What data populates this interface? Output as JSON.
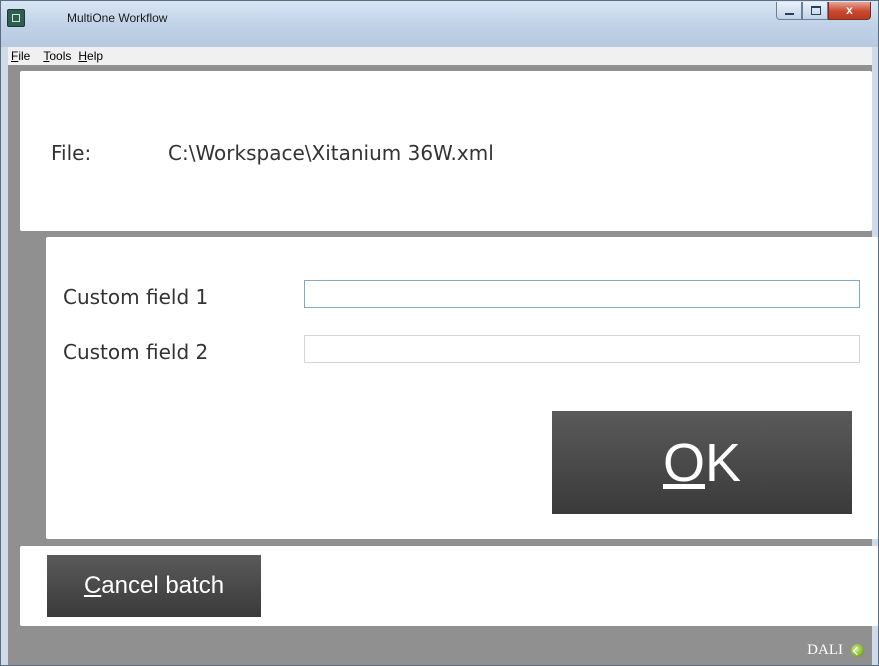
{
  "window": {
    "title": "MultiOne Workflow",
    "controls": [
      "minimize-icon",
      "maximize-icon",
      "close-icon"
    ]
  },
  "menu": {
    "file": {
      "mnemonic": "F",
      "rest": "ile"
    },
    "tools": {
      "mnemonic": "T",
      "rest": "ools"
    },
    "help": {
      "mnemonic": "H",
      "rest": "elp"
    }
  },
  "file_panel": {
    "label": "File:",
    "path": "C:\\Workspace\\Xitanium 36W.xml"
  },
  "form": {
    "field1": {
      "label": "Custom field 1",
      "value": "",
      "placeholder": ""
    },
    "field2": {
      "label": "Custom field 2",
      "value": "",
      "placeholder": ""
    },
    "ok": {
      "mnemonic": "O",
      "rest": "K"
    }
  },
  "bottom": {
    "cancel": {
      "mnemonic": "C",
      "rest": "ancel batch"
    }
  },
  "status": {
    "protocol": "DALI",
    "indicator_icon": "status-ok-icon",
    "indicator_color": "#7fb52a"
  },
  "colors": {
    "titlebar": "#c2d3e8",
    "button_dark": "#4a4a4a",
    "background_gray": "#909090"
  }
}
